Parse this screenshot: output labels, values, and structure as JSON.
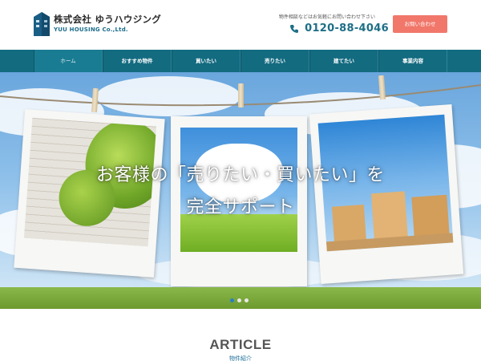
{
  "header": {
    "company_name": "株式会社 ゆうハウジング",
    "company_name_en": "YUU HOUSING Co.,Ltd.",
    "logo_mark_text": "YUU HOUSING",
    "contact_note": "物件相談などはお気軽にお問い合わせ下さい",
    "phone": "0120-88-4046",
    "cta_label": "お問い合わせ"
  },
  "nav": {
    "items": [
      {
        "label": "ホーム",
        "active": true
      },
      {
        "label": "おすすめ物件",
        "active": false
      },
      {
        "label": "買いたい",
        "active": false
      },
      {
        "label": "売りたい",
        "active": false
      },
      {
        "label": "建てたい",
        "active": false
      },
      {
        "label": "事業内容",
        "active": false
      }
    ]
  },
  "hero": {
    "line1": "お客様の「売りたい・買いたい」を",
    "line2": "完全サポート",
    "slides_total": 3,
    "slide_active_index": 0
  },
  "article": {
    "title": "ARTICLE",
    "subtitle": "物件紹介"
  },
  "colors": {
    "nav_bg": "#136b80",
    "cta_bg": "#f1776a",
    "phone_text": "#1d6f86",
    "dot_active": "#2a7fc0"
  }
}
